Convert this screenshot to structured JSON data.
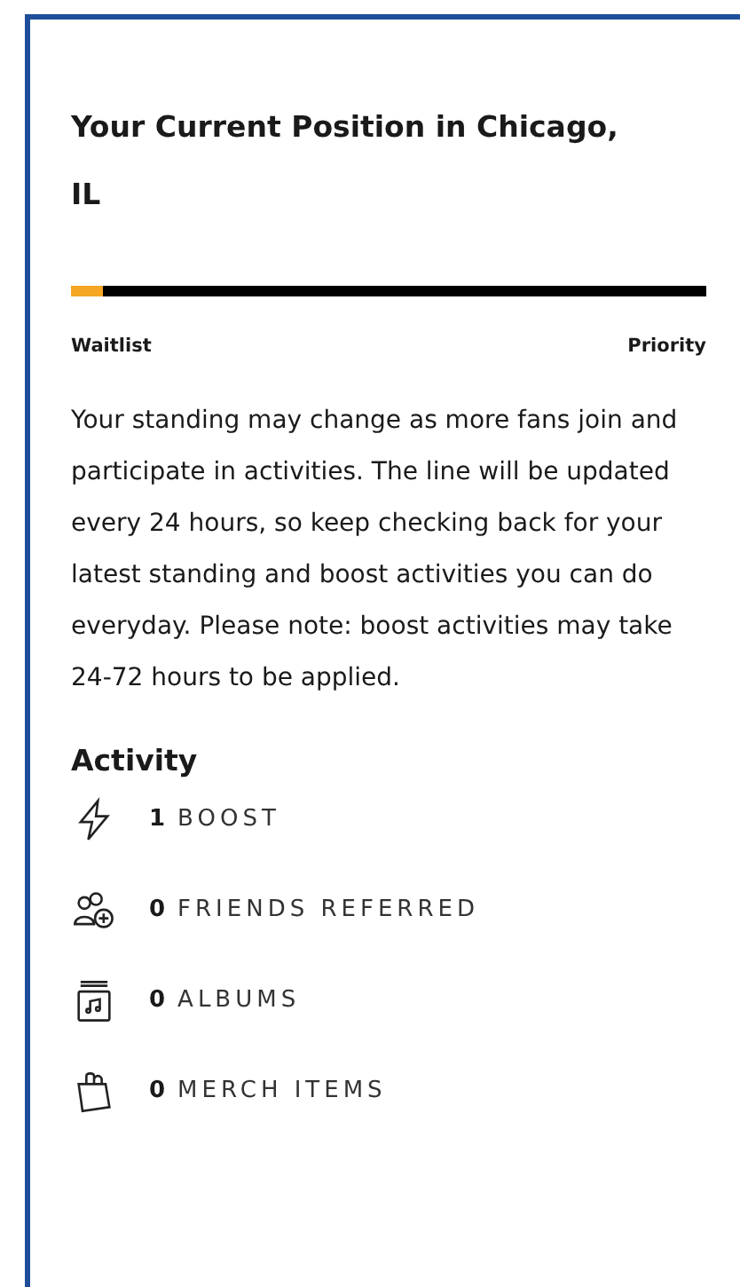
{
  "title": "Your Current Position in Chicago, IL",
  "progress": {
    "level": 0.05,
    "start_label": "Waitlist",
    "end_label": "Priority"
  },
  "description": "Your standing may change as more fans join and participate in activities. The line will be updated every 24 hours, so keep checking back for your latest standing and boost activities you can do everyday. Please note: boost activities may take 24-72 hours to be applied.",
  "activity": {
    "heading": "Activity",
    "items": [
      {
        "kind": "boost",
        "count": "1",
        "label": "BOOST"
      },
      {
        "kind": "friends",
        "count": "0",
        "label": "FRIENDS REFERRED"
      },
      {
        "kind": "albums",
        "count": "0",
        "label": "ALBUMS"
      },
      {
        "kind": "merch",
        "count": "0",
        "label": "MERCH ITEMS"
      }
    ]
  }
}
